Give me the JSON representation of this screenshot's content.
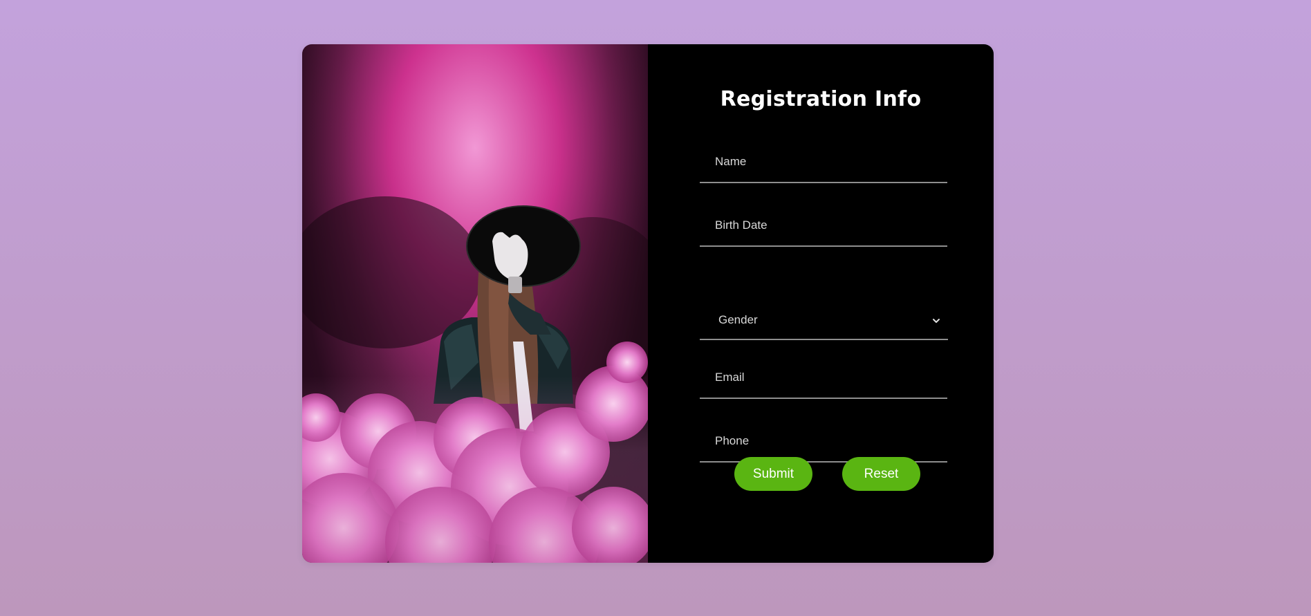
{
  "page": {
    "background_colors": [
      "#c3a2dc",
      "#bd97bc"
    ]
  },
  "hero_image": {
    "description_icon": "person-in-pink-smoke-photo"
  },
  "form": {
    "title": "Registration Info",
    "fields": {
      "name": {
        "placeholder": "Name",
        "value": ""
      },
      "birth_date": {
        "placeholder": "Birth Date",
        "value": ""
      },
      "gender": {
        "selected": "Gender",
        "icon": "chevron-down-icon"
      },
      "email": {
        "placeholder": "Email",
        "value": ""
      },
      "phone": {
        "placeholder": "Phone",
        "value": ""
      }
    },
    "buttons": {
      "submit_label": "Submit",
      "reset_label": "Reset"
    },
    "colors": {
      "panel": "#000000",
      "button": "#5ab512",
      "underline": "#8e8e8e"
    }
  }
}
